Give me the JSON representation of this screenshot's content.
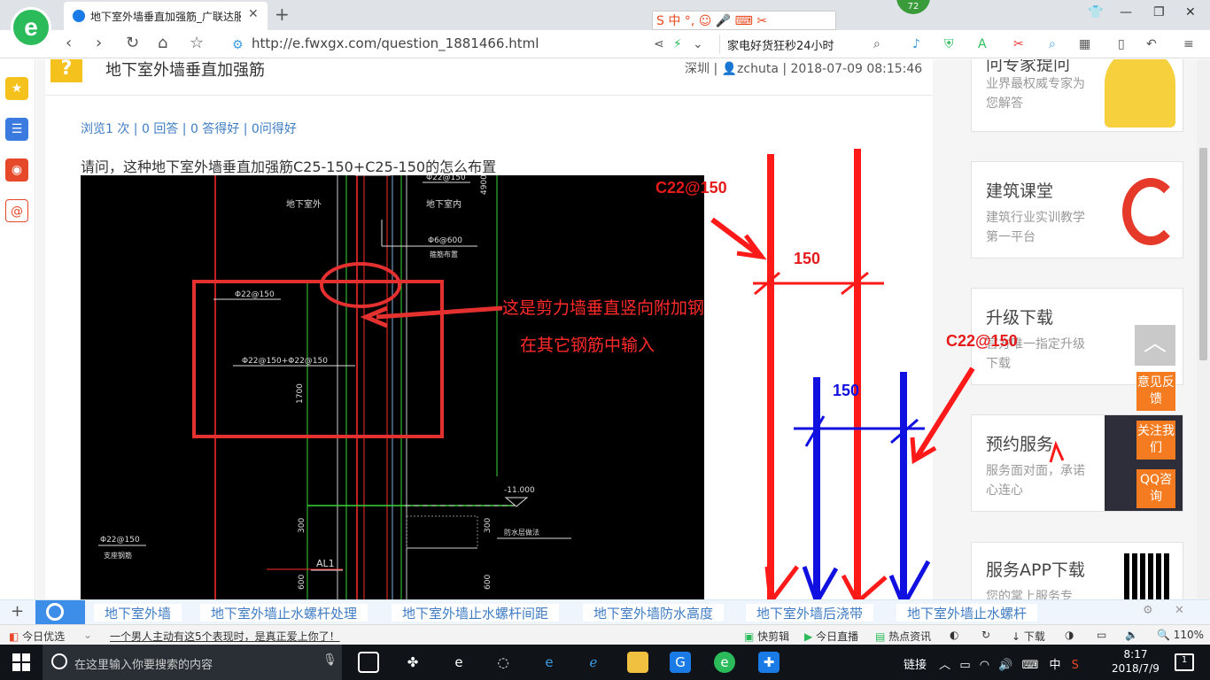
{
  "browser": {
    "tab_title": "地下室外墙垂直加强筋_广联达服",
    "url": "http://e.fwxgx.com/question_1881466.html",
    "address_search_placeholder": "家电好货狂秒24小时",
    "ime_label": "S 中 °,",
    "badge": "72"
  },
  "question": {
    "title": "地下室外墙垂直加强筋",
    "meta": "深圳 | 👤zchuta | 2018-07-09 08:15:46",
    "stats": "浏览1 次 | 0 回答 | 0 答得好 | 0问得好",
    "text": "请问，这种地下室外墙垂直加强筋C25-150+C25-150的怎么布置"
  },
  "cad": {
    "label_outside": "地下室外",
    "label_inside": "地下室内",
    "bar_top": "Φ22@150",
    "bar_combined": "Φ22@150+Φ22@150",
    "dim_1700": "1700",
    "dim_4900": "4900",
    "dim_300a": "300",
    "dim_300b": "300",
    "dim_600a": "600",
    "dim_600b": "600",
    "stirrup": "Φ6@600",
    "stirrup_note": "箍筋布置",
    "level": "-11.000",
    "left_bar": "Φ22@150",
    "left_note": "支座钢筋",
    "al1": "AL1",
    "waterproof": "防水层做法",
    "annotation_1": "这是剪力墙垂直竖向附加钢",
    "annotation_2": "在其它钢筋中输入"
  },
  "sketch": {
    "red_label": "C22@150",
    "red_spacing": "150",
    "blue_label": "C22@150",
    "blue_spacing": "150"
  },
  "right_cards": [
    {
      "title": "问专家提问",
      "desc": "业界最权威专家为您解答"
    },
    {
      "title": "建筑课堂",
      "desc": "建筑行业实训教学第一平台"
    },
    {
      "title": "升级下载",
      "desc": "官方唯一指定升级下载"
    },
    {
      "title": "预约服务",
      "desc": "服务面对面，承诺心连心"
    },
    {
      "title": "服务APP下载",
      "desc": "您的掌上服务专"
    }
  ],
  "float_buttons": [
    "意见反馈",
    "关注我们",
    "QQ咨询"
  ],
  "related": [
    "地下室外墙",
    "地下室外墙止水螺杆处理",
    "地下室外墙止水螺杆间距",
    "地下室外墙防水高度",
    "地下室外墙后浇带",
    "地下室外墙止水螺杆"
  ],
  "statusbar": {
    "today": "今日优选",
    "news": "一个男人主动有这5个表现时，是真正爱上你了！",
    "screenshot": "快剪辑",
    "live": "今日直播",
    "hot": "热点资讯",
    "download": "下载",
    "zoom": "110%"
  },
  "taskbar": {
    "search_placeholder": "在这里输入你要搜索的内容",
    "tray_text": "链接",
    "ime": "中",
    "time": "8:17",
    "date": "2018/7/9",
    "notif_count": "1"
  },
  "colors": {
    "accent_green": "#2bbb5a",
    "link_blue": "#3f7cc3",
    "sketch_red": "#ff1a1a",
    "sketch_blue": "#1010e0"
  }
}
